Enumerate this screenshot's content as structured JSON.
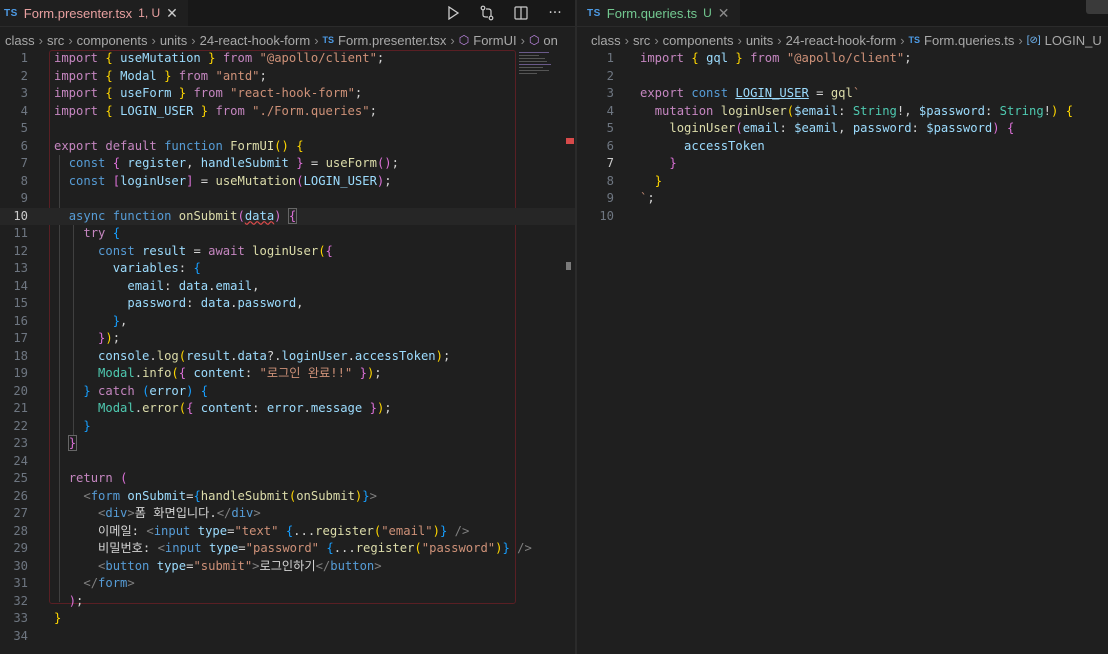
{
  "left": {
    "tab": {
      "badge": "TS",
      "name": "Form.presenter.tsx",
      "status": "1, U",
      "close": "✕"
    },
    "breadcrumb": [
      {
        "text": "class"
      },
      {
        "text": "src"
      },
      {
        "text": "components"
      },
      {
        "text": "units"
      },
      {
        "text": "24-react-hook-form"
      },
      {
        "text": "Form.presenter.tsx",
        "badge": "TS"
      },
      {
        "text": "FormUI",
        "icon": "cube"
      },
      {
        "text": "on",
        "icon": "cube"
      }
    ],
    "actions": [
      "run-icon",
      "compare-changes-icon",
      "split-editor-icon",
      "more-actions-icon"
    ],
    "active_line": 10
  },
  "right": {
    "tab": {
      "badge": "TS",
      "name": "Form.queries.ts",
      "status": "U",
      "close": "✕"
    },
    "breadcrumb": [
      {
        "text": "class"
      },
      {
        "text": "src"
      },
      {
        "text": "components"
      },
      {
        "text": "units"
      },
      {
        "text": "24-react-hook-form"
      },
      {
        "text": "Form.queries.ts",
        "badge": "TS"
      },
      {
        "text": "LOGIN_U",
        "icon": "symbol"
      }
    ],
    "active_line": 7
  },
  "colors": {
    "background": "#1f1f1f",
    "keyword": "#569cd6",
    "control": "#c586c0",
    "string": "#ce9178",
    "function": "#dcdcaa",
    "variable": "#9cdcfe",
    "type": "#4ec9b0",
    "error": "#d74a4a"
  }
}
